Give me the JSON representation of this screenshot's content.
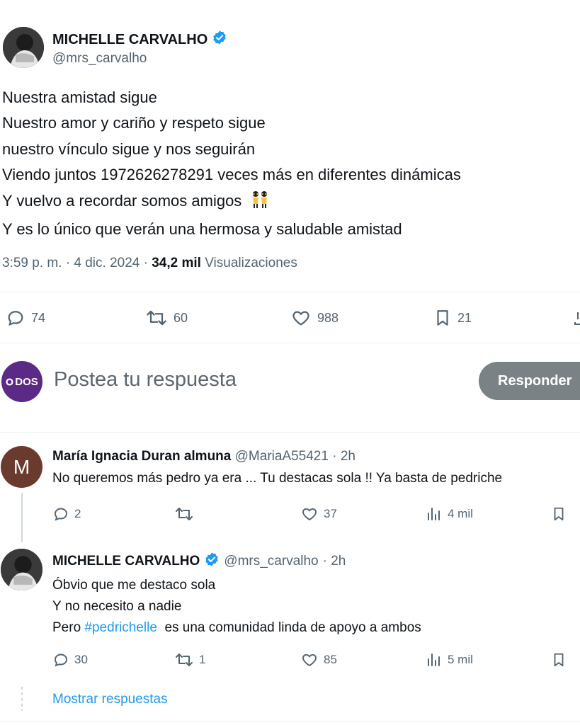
{
  "main_tweet": {
    "author_name": "MICHELLE CARVALHO",
    "author_handle": "@mrs_carvalho",
    "lines": [
      "Nuestra amistad sigue",
      "Nuestro amor y cariño y respeto sigue",
      "nuestro vínculo sigue y nos seguirán",
      "Viendo juntos 1972626278291 veces más en diferentes dinámicas",
      "Y vuelvo a recordar somos amigos",
      "Y es lo único que verán una hermosa y saludable amistad"
    ],
    "emoji": "👯",
    "time": "3:59 p. m. · 4 dic. 2024 · ",
    "views_count": "34,2 mil",
    "views_label": "Visualizaciones",
    "replies": "74",
    "retweets": "60",
    "likes": "988",
    "bookmarks": "21"
  },
  "composer": {
    "avatar_text": "DOS",
    "placeholder": "Postea tu respuesta",
    "reply_button": "Responder"
  },
  "reply_1": {
    "avatar_letter": "M",
    "author_name": "María Ignacia Duran almuna",
    "author_handle": "@MariaA55421",
    "time": "· 2h",
    "text": "No queremos más pedro ya era ... Tu destacas sola !! Ya basta de pedriche",
    "replies": "2",
    "retweets": "",
    "likes": "37",
    "views": "4 mil"
  },
  "reply_2": {
    "author_name": "MICHELLE CARVALHO",
    "author_handle": "@mrs_carvalho",
    "time": "· 2h",
    "line1": "Óbvio que me destaco sola",
    "line2": "Y no necesito a nadie",
    "line3_prefix": "Pero ",
    "hashtag": "#pedrichelle",
    "line3_suffix": "  es una comunidad linda de apoyo a ambos",
    "replies": "30",
    "retweets": "1",
    "likes": "85",
    "views": "5 mil"
  },
  "show_replies": "Mostrar respuestas",
  "colors": {
    "link": "#1d9bf0",
    "muted": "#536471",
    "dos_purple": "#5b2a86",
    "reply_avatar": "#6b3a2e",
    "button_gray": "#7b8286"
  }
}
